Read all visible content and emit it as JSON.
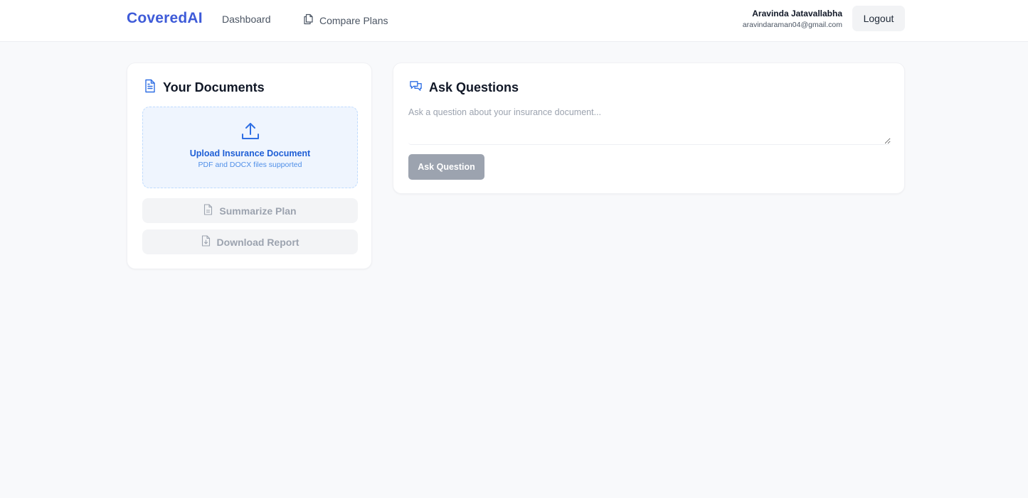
{
  "header": {
    "brand": "CoveredAI",
    "nav": {
      "dashboard": "Dashboard",
      "compare": "Compare Plans",
      "compare_icon": "copy-icon"
    },
    "user": {
      "name": "Aravinda Jatavallabha",
      "email": "aravindaraman04@gmail.com"
    },
    "logout_label": "Logout"
  },
  "documents": {
    "title": "Your Documents",
    "title_icon": "file-text-icon",
    "upload": {
      "icon": "upload-icon",
      "title": "Upload Insurance Document",
      "subtitle": "PDF and DOCX files supported"
    },
    "summarize_label": "Summarize Plan",
    "summarize_icon": "file-text-icon",
    "download_label": "Download Report",
    "download_icon": "file-download-icon"
  },
  "ask": {
    "title": "Ask Questions",
    "title_icon": "chat-bubbles-icon",
    "placeholder": "Ask a question about your insurance document...",
    "button_label": "Ask Question"
  },
  "colors": {
    "brand": "#3e5bd8",
    "accent_blue": "#1f5fd6",
    "upload_bg": "#eff5fe",
    "disabled_button": "#9ca3af",
    "page_bg": "#f8f9fb"
  }
}
